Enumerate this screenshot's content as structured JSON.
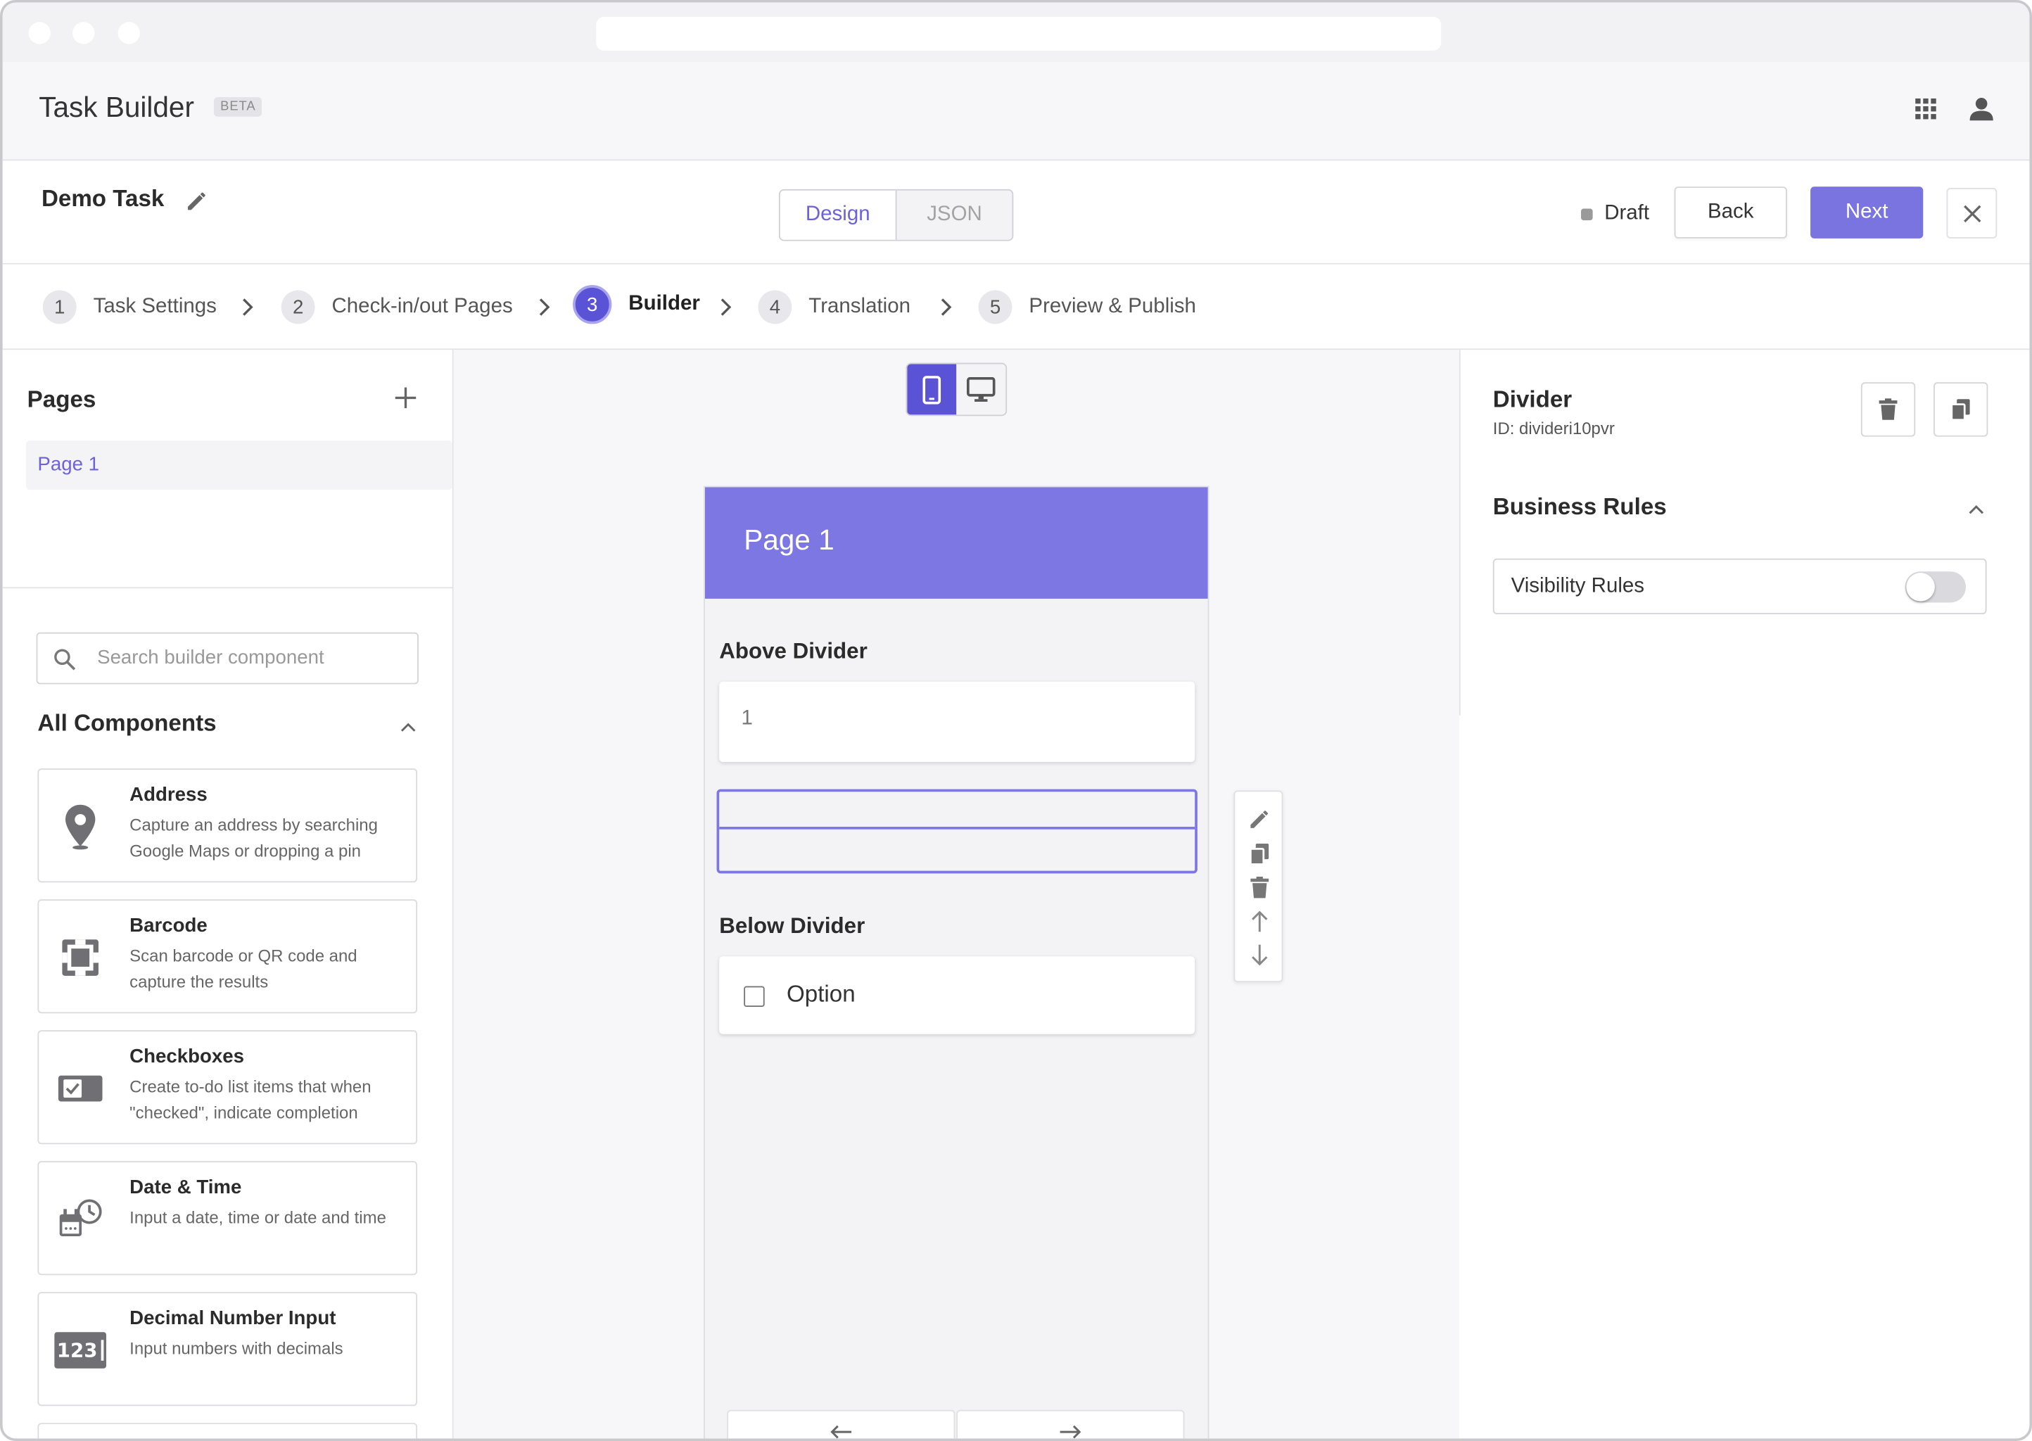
{
  "app": {
    "title": "Task Builder",
    "badge": "BETA"
  },
  "task": {
    "name": "Demo Task",
    "view_tabs": [
      "Design",
      "JSON"
    ],
    "active_tab": "Design",
    "status": "Draft",
    "back_label": "Back",
    "next_label": "Next"
  },
  "steps": [
    {
      "num": "1",
      "label": "Task Settings"
    },
    {
      "num": "2",
      "label": "Check-in/out Pages"
    },
    {
      "num": "3",
      "label": "Builder"
    },
    {
      "num": "4",
      "label": "Translation"
    },
    {
      "num": "5",
      "label": "Preview & Publish"
    }
  ],
  "active_step": "3",
  "sidebar": {
    "pages_heading": "Pages",
    "pages": [
      "Page 1"
    ],
    "search_placeholder": "Search builder component",
    "components_heading": "All Components",
    "components": [
      {
        "title": "Address",
        "desc": "Capture an address by searching Google Maps or dropping a pin",
        "icon": "map-pin-icon"
      },
      {
        "title": "Barcode",
        "desc": "Scan barcode or QR code and capture the results",
        "icon": "barcode-scan-icon"
      },
      {
        "title": "Checkboxes",
        "desc": "Create to-do list items that when \"checked\", indicate completion",
        "icon": "checkbox-icon"
      },
      {
        "title": "Date & Time",
        "desc": "Input a date, time or date and time",
        "icon": "calendar-clock-icon"
      },
      {
        "title": "Decimal Number Input",
        "desc": "Input numbers with decimals",
        "icon": "number-input-icon",
        "icon_text": "123"
      }
    ]
  },
  "canvas": {
    "device": "mobile",
    "page_title": "Page 1",
    "above_label": "Above Divider",
    "above_value": "1",
    "below_label": "Below Divider",
    "option_label": "Option"
  },
  "properties": {
    "component_name": "Divider",
    "component_id": "ID: divideri10pvr",
    "section_title": "Business Rules",
    "visibility_label": "Visibility Rules",
    "visibility_enabled": false
  },
  "colors": {
    "accent": "#7d77e4",
    "accent_dark": "#5b53d6",
    "next_button": "#7a74e0"
  }
}
